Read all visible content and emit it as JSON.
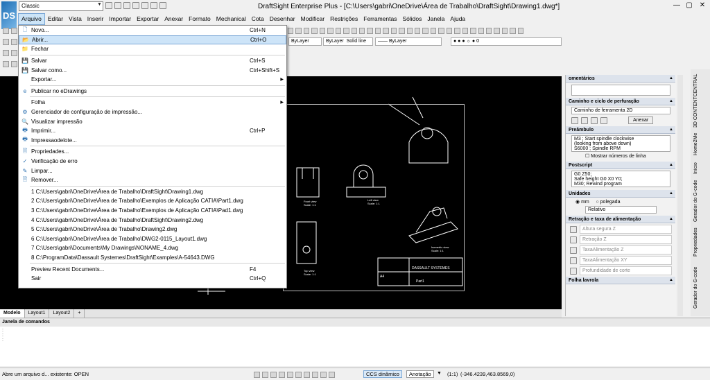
{
  "app": {
    "logo": "DS",
    "workspace": "Classic",
    "title": "DraftSight Enterprise Plus - [C:\\Users\\gabri\\OneDrive\\Área de Trabalho\\DraftSight\\Drawing1.dwg*]"
  },
  "menu": [
    "Arquivo",
    "Editar",
    "Vista",
    "Inserir",
    "Importar",
    "Exportar",
    "Anexar",
    "Formato",
    "Mechanical",
    "Cota",
    "Desenhar",
    "Modificar",
    "Restrições",
    "Ferramentas",
    "Sólidos",
    "Janela",
    "Ajuda"
  ],
  "toolbar": {
    "linetype1": "ByLayer",
    "linetype2": "ByLayer",
    "linestyle": "Solid line",
    "lineweight": "—— ByLayer",
    "layer": "0"
  },
  "file_menu": {
    "items": [
      {
        "label": "Novo...",
        "shortcut": "Ctrl+N",
        "icon": "🗋"
      },
      {
        "label": "Abrir...",
        "shortcut": "Ctrl+O",
        "icon": "📂",
        "highlight": true
      },
      {
        "label": "Fechar",
        "shortcut": "",
        "icon": "📁"
      },
      {
        "sep": true
      },
      {
        "label": "Salvar",
        "shortcut": "Ctrl+S",
        "icon": "💾"
      },
      {
        "label": "Salvar como...",
        "shortcut": "Ctrl+Shift+S",
        "icon": "💾"
      },
      {
        "label": "Exportar...",
        "shortcut": "",
        "icon": "",
        "submenu": true
      },
      {
        "sep": true
      },
      {
        "label": "Publicar no eDrawings",
        "shortcut": "",
        "icon": "e"
      },
      {
        "sep": true
      },
      {
        "label": "Folha",
        "shortcut": "",
        "icon": "",
        "submenu": true
      },
      {
        "label": "Gerenciador de configuração de impressão...",
        "shortcut": "",
        "icon": "⚙"
      },
      {
        "label": "Visualizar impressão",
        "shortcut": "",
        "icon": "🔍"
      },
      {
        "label": "Imprimir...",
        "shortcut": "Ctrl+P",
        "icon": "🖶"
      },
      {
        "label": "Impressaodelote...",
        "shortcut": "",
        "icon": "🖶"
      },
      {
        "sep": true
      },
      {
        "label": "Propriedades...",
        "shortcut": "",
        "icon": "🗎"
      },
      {
        "label": "Verificação de erro",
        "shortcut": "",
        "icon": "✓"
      },
      {
        "label": "Limpar...",
        "shortcut": "",
        "icon": "✎"
      },
      {
        "label": "Remover...",
        "shortcut": "",
        "icon": "🗎"
      },
      {
        "sep": true
      },
      {
        "label": "1 C:\\Users\\gabri\\OneDrive\\Área de Trabalho\\DraftSight\\Drawing1.dwg",
        "shortcut": "",
        "icon": ""
      },
      {
        "label": "2 C:\\Users\\gabri\\OneDrive\\Área de Trabalho\\Exemplos de Aplicação CATIA\\Part1.dwg",
        "shortcut": "",
        "icon": ""
      },
      {
        "label": "3 C:\\Users\\gabri\\OneDrive\\Área de Trabalho\\Exemplos de Aplicação CATIA\\Pad1.dwg",
        "shortcut": "",
        "icon": ""
      },
      {
        "label": "4 C:\\Users\\gabri\\OneDrive\\Área de Trabalho\\DraftSight\\Drawing2.dwg",
        "shortcut": "",
        "icon": ""
      },
      {
        "label": "5 C:\\Users\\gabri\\OneDrive\\Área de Trabalho\\Drawing2.dwg",
        "shortcut": "",
        "icon": ""
      },
      {
        "label": "6 C:\\Users\\gabri\\OneDrive\\Área de Trabalho\\DWG2-0115_Layout1.dwg",
        "shortcut": "",
        "icon": ""
      },
      {
        "label": "7 C:\\Users\\gabri\\Documents\\My Drawings\\NONAME_4.dwg",
        "shortcut": "",
        "icon": ""
      },
      {
        "label": "8 C:\\ProgramData\\Dassault Systemes\\DraftSight\\Examples\\A-54643.DWG",
        "shortcut": "",
        "icon": ""
      },
      {
        "sep": true
      },
      {
        "label": "Preview Recent Documents...",
        "shortcut": "F4",
        "icon": ""
      },
      {
        "label": "Sair",
        "shortcut": "Ctrl+Q",
        "icon": ""
      }
    ]
  },
  "drawing": {
    "views": [
      "Front view",
      "Left view",
      "Top view",
      "Isometric view"
    ],
    "scale": "Scale: 1:1",
    "company": "DASSAULT SYSTEMES",
    "part": "Part1",
    "size": "A4"
  },
  "tabs": [
    "Modelo",
    "Layout1",
    "Layout2",
    "+"
  ],
  "panel": {
    "comments": "omentários",
    "path_section": "Caminho e ciclo de perfuração",
    "path_value": "Caminho de ferramenta 2D",
    "attach": "Anexar",
    "preamble": "Preâmbulo",
    "preamble_text": "M3      ; Start spindle clockwise\n(looking from above down)\nS6000   ; Spindle RPM",
    "show_lines": "Mostrar números de linha",
    "postscript": "Postscript",
    "postscript_text": "G0 Z50;\nSafe height G0 X0 Y0;\nM30; Rewind program",
    "units": "Unidades",
    "mm": "mm",
    "inch": "polegada",
    "relative": "Relativo",
    "feed": "Retração e taxa de alimentação",
    "fields": [
      "Altura segura Z",
      "Retração Z",
      "TaxaAlimentação Z",
      "TaxaAlimentação XY",
      "Profundidade de corte"
    ],
    "bottom": "Folha lavrola"
  },
  "vtabs": [
    "3D CONTENTCENTRAL",
    "Home2Me",
    "Início",
    "Gerador do G-code",
    "Propriedades",
    "Gerador do G-code"
  ],
  "cmd": {
    "title": "Janela de comandos"
  },
  "status": {
    "message": "Abre um arquivo d... existente:  OPEN",
    "ccs": "CCS dinâmico",
    "annotation": "Anotação",
    "scale": "(1:1)",
    "coords": "(-346.4239,463.8569,0)"
  }
}
